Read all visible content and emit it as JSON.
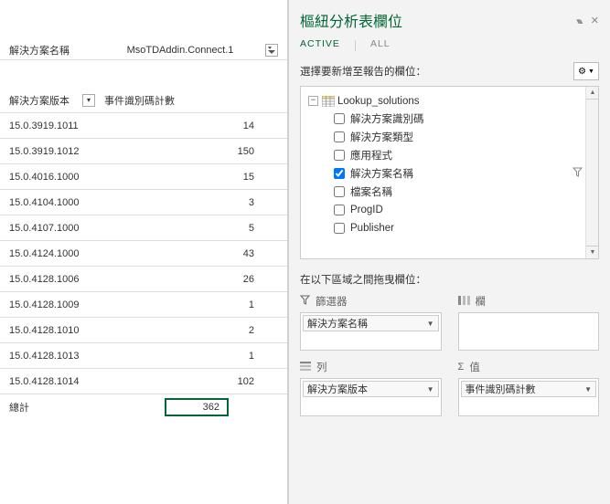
{
  "pane_title": "樞紐分析表欄位",
  "tabs": {
    "active": "ACTIVE",
    "all": "ALL"
  },
  "select_fields_label": "選擇要新增至報告的欄位：",
  "filter": {
    "label": "解決方案名稱",
    "value": "MsoTDAddin.Connect.1"
  },
  "columns": {
    "row_header": "解決方案版本",
    "value_header": "事件識別碼計數"
  },
  "rows": [
    {
      "k": "15.0.3919.1011",
      "v": "14"
    },
    {
      "k": "15.0.3919.1012",
      "v": "150"
    },
    {
      "k": "15.0.4016.1000",
      "v": "15"
    },
    {
      "k": "15.0.4104.1000",
      "v": "3"
    },
    {
      "k": "15.0.4107.1000",
      "v": "5"
    },
    {
      "k": "15.0.4124.1000",
      "v": "43"
    },
    {
      "k": "15.0.4128.1006",
      "v": "26"
    },
    {
      "k": "15.0.4128.1009",
      "v": "1"
    },
    {
      "k": "15.0.4128.1010",
      "v": "2"
    },
    {
      "k": "15.0.4128.1013",
      "v": "1"
    },
    {
      "k": "15.0.4128.1014",
      "v": "102"
    }
  ],
  "total": {
    "label": "總計",
    "value": "362"
  },
  "tree": {
    "table_name": "Lookup_solutions",
    "fields": [
      {
        "label": "解決方案識別碼",
        "checked": false
      },
      {
        "label": "解決方案類型",
        "checked": false
      },
      {
        "label": "應用程式",
        "checked": false
      },
      {
        "label": "解決方案名稱",
        "checked": true,
        "has_filter": true
      },
      {
        "label": "檔案名稱",
        "checked": false
      },
      {
        "label": "ProgID",
        "checked": false
      },
      {
        "label": "Publisher",
        "checked": false
      }
    ]
  },
  "drag_label": "在以下區域之間拖曳欄位：",
  "quadrants": {
    "filters": {
      "title": "篩選器",
      "item": "解決方案名稱"
    },
    "columns": {
      "title": "欄"
    },
    "rows": {
      "title": "列",
      "item": "解決方案版本"
    },
    "values": {
      "title": "值",
      "item": "事件識別碼計數"
    }
  }
}
